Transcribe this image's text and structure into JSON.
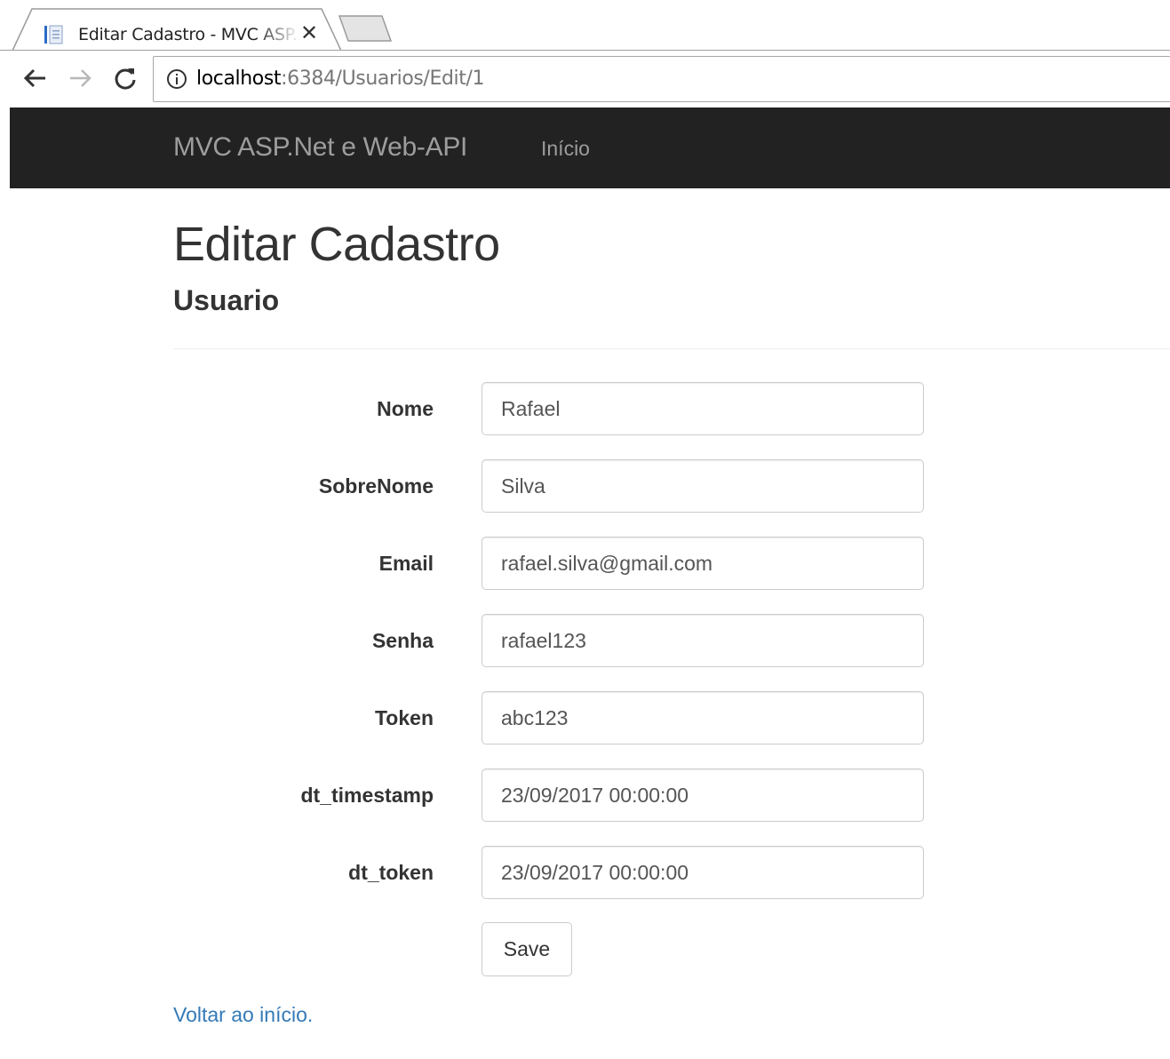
{
  "browser": {
    "tab_title": "Editar Cadastro - MVC ASP.Net e Web-API",
    "close_glyph": "✕",
    "url_host": "localhost",
    "url_path": ":6384/Usuarios/Edit/1"
  },
  "navbar": {
    "brand": "MVC ASP.Net e Web-API",
    "link_home": "Início"
  },
  "page": {
    "title": "Editar Cadastro",
    "subtitle": "Usuario"
  },
  "form": {
    "fields": [
      {
        "label": "Nome",
        "value": "Rafael"
      },
      {
        "label": "SobreNome",
        "value": "Silva"
      },
      {
        "label": "Email",
        "value": "rafael.silva@gmail.com"
      },
      {
        "label": "Senha",
        "value": "rafael123"
      },
      {
        "label": "Token",
        "value": "abc123"
      },
      {
        "label": "dt_timestamp",
        "value": "23/09/2017 00:00:00"
      },
      {
        "label": "dt_token",
        "value": "23/09/2017 00:00:00"
      }
    ],
    "save_label": "Save"
  },
  "footer": {
    "back_link": "Voltar ao início."
  },
  "colors": {
    "navbar_bg": "#222222",
    "navbar_text": "#9d9d9d",
    "link": "#337ab7"
  }
}
